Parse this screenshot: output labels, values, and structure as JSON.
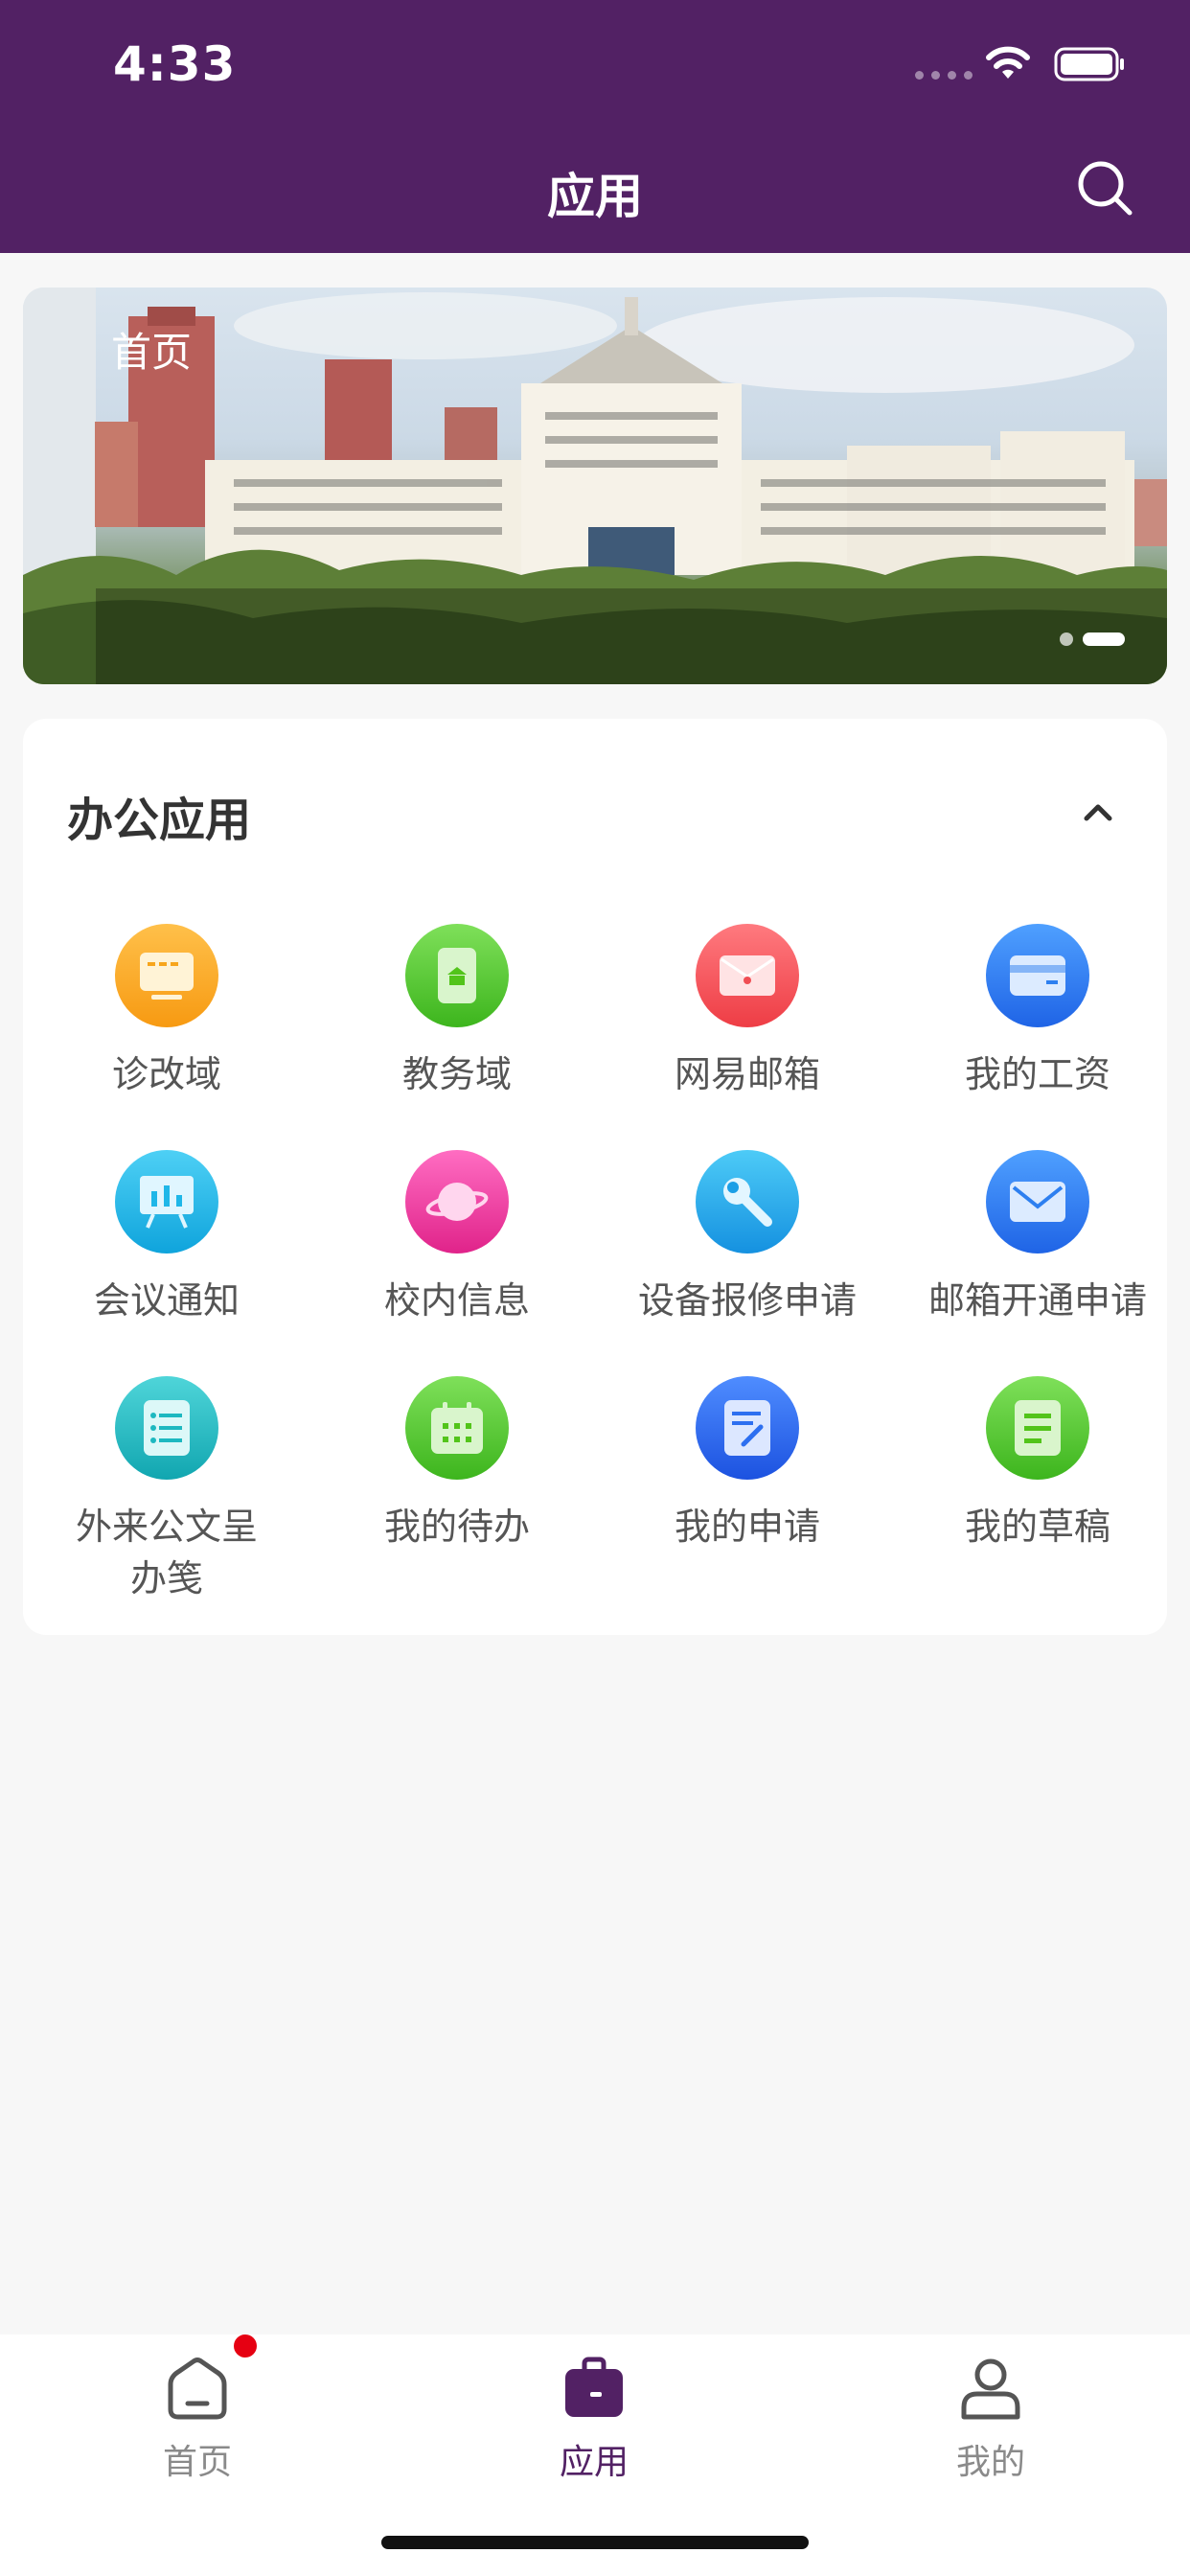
{
  "status_bar": {
    "time": "4:33"
  },
  "header": {
    "title": "应用"
  },
  "banner": {
    "caption": "首页",
    "page_count": 2,
    "active_index": 1
  },
  "section": {
    "title": "办公应用",
    "apps": [
      {
        "label": "诊改域",
        "icon": "monitor-icon",
        "color": "#f7a51c"
      },
      {
        "label": "教务域",
        "icon": "school-phone-icon",
        "color": "#52c41a"
      },
      {
        "label": "网易邮箱",
        "icon": "envelope-icon",
        "color": "#f04e54"
      },
      {
        "label": "我的工资",
        "icon": "wallet-card-icon",
        "color": "#2d7ff0"
      },
      {
        "label": "会议通知",
        "icon": "presentation-board-icon",
        "color": "#1fb7e8"
      },
      {
        "label": "校内信息",
        "icon": "planet-icon",
        "color": "#ec3d9e"
      },
      {
        "label": "设备报修申请",
        "icon": "wrench-icon",
        "color": "#1c9fe6"
      },
      {
        "label": "邮箱开通申请",
        "icon": "mail-icon",
        "color": "#2d7ff0"
      },
      {
        "label": "外来公文呈\n办笺",
        "icon": "document-list-icon",
        "color": "#1db8c0"
      },
      {
        "label": "我的待办",
        "icon": "calendar-icon",
        "color": "#52c41a"
      },
      {
        "label": "我的申请",
        "icon": "edit-document-icon",
        "color": "#2d6ff0"
      },
      {
        "label": "我的草稿",
        "icon": "notebook-icon",
        "color": "#52c41a"
      }
    ]
  },
  "tabbar": {
    "tabs": [
      {
        "label": "首页",
        "icon": "home-icon",
        "has_badge": true
      },
      {
        "label": "应用",
        "icon": "briefcase-icon",
        "active": true
      },
      {
        "label": "我的",
        "icon": "person-icon"
      }
    ]
  },
  "colors": {
    "brand": "#522164",
    "badge": "#e60012"
  }
}
